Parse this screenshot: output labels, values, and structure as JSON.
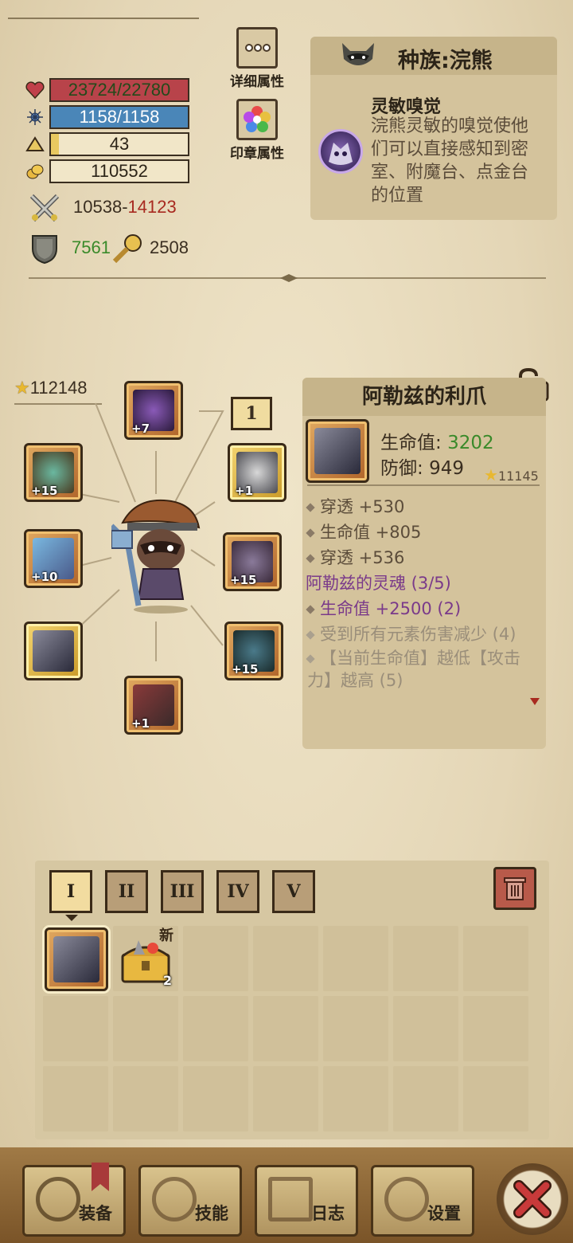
{
  "top_buttons": {
    "detail_label": "详细属性",
    "seal_label": "印章属性"
  },
  "stats": {
    "hp": "23724/22780",
    "mp": "1158/1158",
    "level": "43",
    "gold": "110552",
    "attack_min": "10538",
    "attack_sep": "-",
    "attack_max": "14123",
    "defense": "7561",
    "crit": "2508"
  },
  "stat_fill": {
    "hp": 1.0,
    "mp": 1.0,
    "level": 0.06,
    "gold": 0.0
  },
  "race": {
    "title": "种族:浣熊",
    "skill_name": "灵敏嗅觉",
    "skill_desc": "浣熊灵敏的嗅觉使他们可以直接感知到密室、附魔台、点金台的位置"
  },
  "equip": {
    "total_score": "112148",
    "lock_number": "1",
    "slots": [
      {
        "name": "helmet",
        "level": "+7"
      },
      {
        "name": "amulet",
        "level": "+15"
      },
      {
        "name": "necklace",
        "level": "+1"
      },
      {
        "name": "weapon",
        "level": "+10"
      },
      {
        "name": "shoulder",
        "level": "+15"
      },
      {
        "name": "claw",
        "level": ""
      },
      {
        "name": "armor",
        "level": "+15"
      },
      {
        "name": "boots",
        "level": "+1"
      }
    ]
  },
  "item": {
    "title": "阿勒兹的利爪",
    "hp_label": "生命值: ",
    "hp_value": "3202",
    "def_label": "防御: ",
    "def_value": "949",
    "score": "11145",
    "attrs": [
      "穿透 +530",
      "生命值 +805",
      "穿透 +536"
    ],
    "set_name": "阿勒兹的灵魂 (3/5)",
    "set_bonus_active": "生命值 +2500 (2)",
    "set_bonus_2": "受到所有元素伤害减少 (4)",
    "set_bonus_3": "【当前生命值】越低【攻击力】越高 (5)"
  },
  "inventory": {
    "tabs": [
      "I",
      "II",
      "III",
      "IV",
      "V"
    ],
    "new_badge": "新",
    "chest_count": "2"
  },
  "nav": {
    "equip": "装备",
    "skill": "技能",
    "log": "日志",
    "settings": "设置"
  },
  "colors": {
    "hp": "#b8434a",
    "mp": "#4a86b8",
    "level": "#e8c860",
    "green": "#3a8a2a",
    "red": "#a82a20",
    "purple": "#7a3a8a"
  }
}
